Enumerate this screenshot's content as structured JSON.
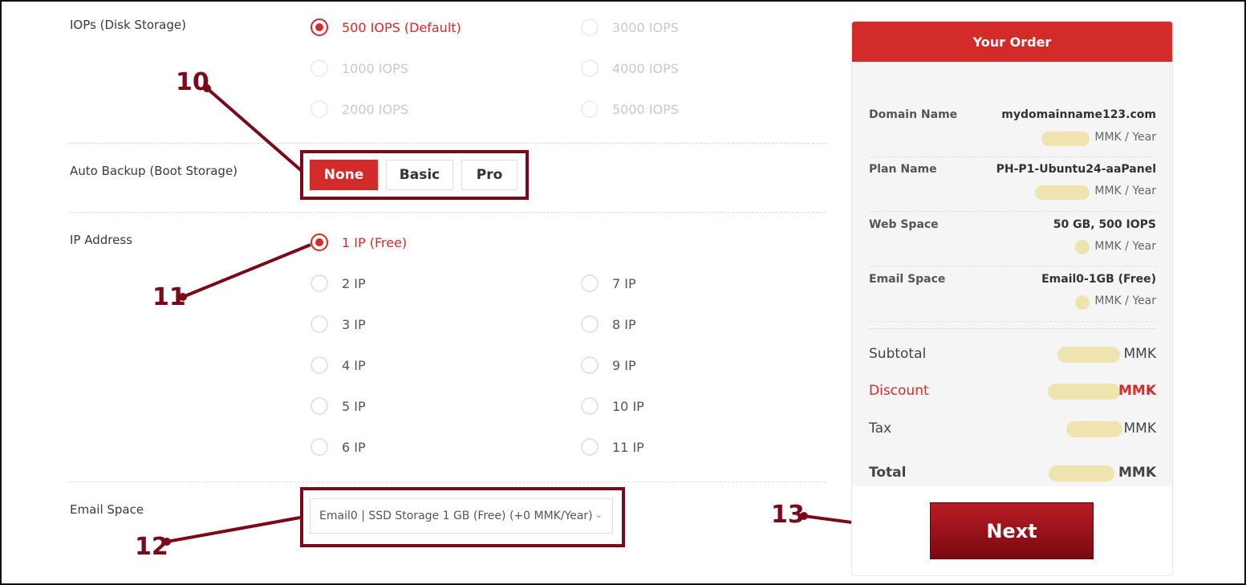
{
  "iops": {
    "label": "IOPs (Disk Storage)",
    "options": [
      "500 IOPS (Default)",
      "3000 IOPS",
      "1000 IOPS",
      "4000 IOPS",
      "2000 IOPS",
      "5000 IOPS"
    ],
    "selected": "500 IOPS (Default)"
  },
  "backup": {
    "label": "Auto Backup (Boot Storage)",
    "options": [
      "None",
      "Basic",
      "Pro"
    ],
    "selected": "None"
  },
  "ip": {
    "label": "IP Address",
    "options": [
      "1 IP (Free)",
      "2 IP",
      "7 IP",
      "3 IP",
      "8 IP",
      "4 IP",
      "9 IP",
      "5 IP",
      "10 IP",
      "6 IP",
      "11 IP"
    ],
    "selected": "1 IP (Free)"
  },
  "email": {
    "label": "Email Space",
    "select_value": "Email0 | SSD Storage 1 GB (Free) (+0 MMK/Year)"
  },
  "callouts": [
    "10",
    "11",
    "12",
    "13"
  ],
  "order": {
    "title": "Your Order",
    "items": [
      {
        "label": "Domain Name",
        "value": "mydomainname123.com",
        "price_suffix": "MMK / Year"
      },
      {
        "label": "Plan Name",
        "value": "PH-P1-Ubuntu24-aaPanel",
        "price_suffix": "MMK / Year"
      },
      {
        "label": "Web Space",
        "value": "50 GB, 500 IOPS",
        "price_suffix": "MMK / Year"
      },
      {
        "label": "Email Space",
        "value": "Email0-1GB (Free)",
        "price_suffix": "MMK / Year"
      }
    ],
    "summary": {
      "subtotal_label": "Subtotal",
      "subtotal_unit": "MMK",
      "discount_label": "Discount",
      "discount_unit": "MMK",
      "tax_label": "Tax",
      "tax_unit": "MMK",
      "total_label": "Total",
      "total_unit": "MMK"
    },
    "next_label": "Next"
  },
  "colors": {
    "accent": "#d32a2a",
    "callout": "#7a0a1a",
    "redaction": "#efe3b0"
  }
}
